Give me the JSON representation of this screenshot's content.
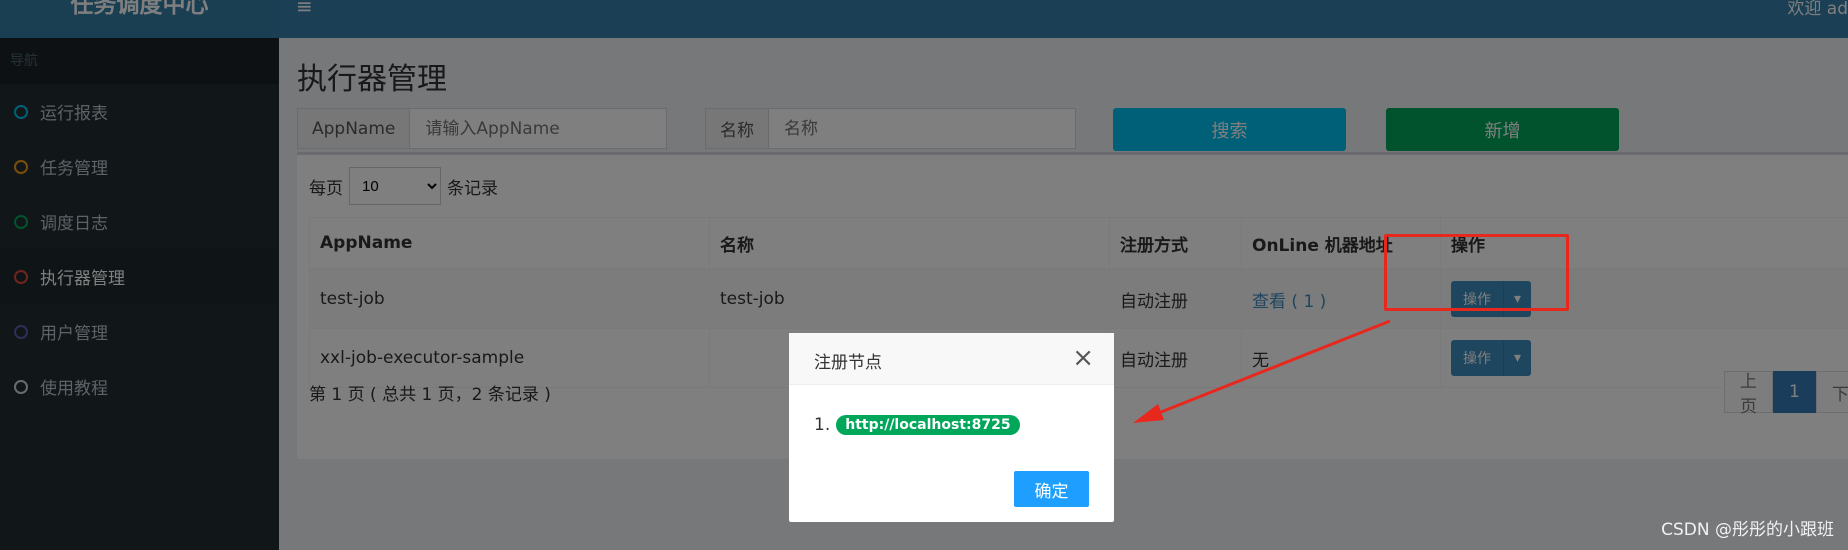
{
  "header": {
    "logo": "任务调度中心",
    "menu_icon": "≡",
    "welcome": "欢迎 ad"
  },
  "sidebar": {
    "header": "导航",
    "items": [
      {
        "label": "运行报表",
        "dot_color": "#00c0ef"
      },
      {
        "label": "任务管理",
        "dot_color": "#f39c12"
      },
      {
        "label": "调度日志",
        "dot_color": "#00a65a"
      },
      {
        "label": "执行器管理",
        "dot_color": "#dd4b39"
      },
      {
        "label": "用户管理",
        "dot_color": "#605ca8"
      },
      {
        "label": "使用教程",
        "dot_color": "#d2d6de"
      }
    ]
  },
  "main": {
    "title": "执行器管理",
    "filters": {
      "appname_label": "AppName",
      "appname_placeholder": "请输入AppName",
      "name_label": "名称",
      "name_placeholder": "名称",
      "search": "搜索",
      "add": "新增"
    },
    "length": {
      "prefix": "每页",
      "value": "10",
      "suffix": "条记录"
    },
    "table": {
      "headers": [
        "AppName",
        "名称",
        "注册方式",
        "OnLine 机器地址",
        "操作"
      ],
      "rows": [
        {
          "appname": "test-job",
          "name": "test-job",
          "reg": "自动注册",
          "online": "查看 ( 1 )",
          "ops": "操作"
        },
        {
          "appname": "xxl-job-executor-sample",
          "name": "",
          "reg": "自动注册",
          "online": "无",
          "ops": "操作"
        }
      ]
    },
    "info": "第 1 页 ( 总共 1 页，2 条记录 )",
    "pager": {
      "prev": "上页",
      "current": "1",
      "next": "下"
    }
  },
  "modal": {
    "title": "注册节点",
    "close": "×",
    "item_index": "1.",
    "address": "http://localhost:8725",
    "ok": "确定"
  },
  "watermark": "CSDN @彤彤的小跟班",
  "colors": {
    "highlight": "#e8271d",
    "topbar": "#367fa9",
    "sidebar": "#222d32"
  }
}
